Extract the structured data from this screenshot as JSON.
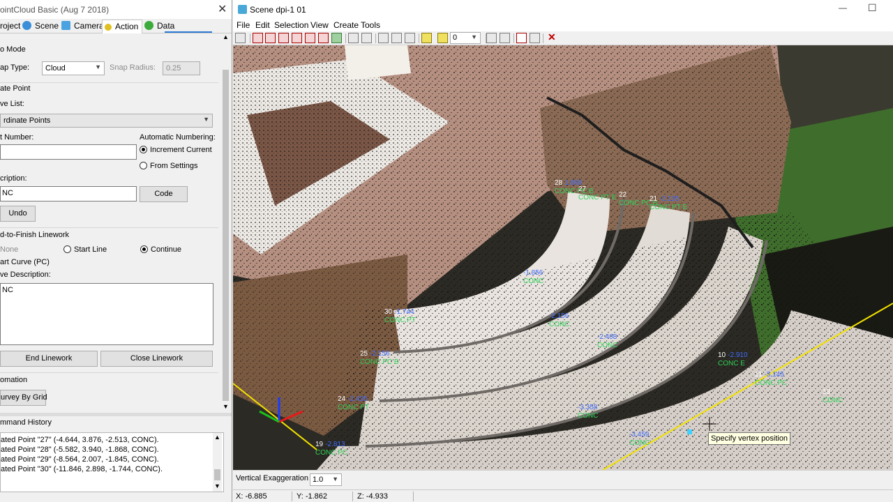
{
  "left_panel": {
    "title": "ointCloud Basic (Aug  7 2018)",
    "close_glyph": "✕",
    "tabs": [
      {
        "label": "roject",
        "icon": "project-icon"
      },
      {
        "label": "Scene",
        "icon": "scene-icon"
      },
      {
        "label": "Camera",
        "icon": "camera-icon"
      },
      {
        "label": "Action",
        "icon": "action-icon"
      },
      {
        "label": "Data",
        "icon": "data-icon"
      }
    ],
    "active_tab": "Action",
    "snap": {
      "group": "o Mode",
      "snap_type_label": "ap Type:",
      "snap_type_value": "Cloud",
      "snap_radius_label": "Snap Radius:",
      "snap_radius_value": "0.25"
    },
    "create_point": {
      "group": "ate Point",
      "save_list_label": "ve List:",
      "save_list_value": "rdinate Points",
      "point_number_label": "t Number:",
      "point_number_value": "",
      "auto_numbering_label": "Automatic Numbering:",
      "increment_current": "Increment Current",
      "from_settings": "From Settings",
      "description_label": "cription:",
      "description_value": "NC",
      "code_button": "Code",
      "undo_button": "Undo"
    },
    "linework": {
      "group": "d-to-Finish Linework",
      "none": "None",
      "start_line": "Start Line",
      "continue": "Continue",
      "start_curve": "art Curve (PC)",
      "curve_desc_label": "ve Description:",
      "curve_desc_value": "NC",
      "end_linework": "End Linework",
      "close_linework": "Close Linework"
    },
    "automation": {
      "group": "omation",
      "survey_by_grid": "urvey By Grid"
    },
    "command_history": {
      "label": "mmand History",
      "lines": [
        "ated Point \"27\" (-4.644, 3.876, -2.513, CONC).",
        "ated Point \"28\" (-5.582, 3.940, -1.868, CONC).",
        "ated Point \"29\" (-8.564, 2.007, -1.845, CONC).",
        "ated Point \"30\" (-11.846, 2.898, -1.744, CONC)."
      ]
    }
  },
  "scene_window": {
    "title": "Scene dpi-1 01",
    "minimize_glyph": "—",
    "maximize_glyph": "☐",
    "menu": [
      "File",
      "Edit",
      "Selection",
      "View",
      "Create",
      "Tools"
    ],
    "toolbar_combo_value": "0",
    "vertical_exaggeration_label": "Vertical Exaggeration",
    "vertical_exaggeration_value": "1.0",
    "status": {
      "x": "X: -6.885",
      "y": "Y: -1.862",
      "z": "Z: -4.933"
    },
    "tooltip": "Specify vertex position",
    "point_labels": [
      {
        "num": "28",
        "code": "CONC PC B",
        "val": "1.868"
      },
      {
        "num": "27",
        "code": "CONC PT E",
        "val": ""
      },
      {
        "num": "22",
        "code": "CONC PC B",
        "val": ""
      },
      {
        "num": "21",
        "code": "CONC PT E",
        "val": "-2.135"
      },
      {
        "num": "",
        "code": "CONC",
        "val": "-1.856"
      },
      {
        "num": "",
        "code": "CONC",
        "val": "-2.156"
      },
      {
        "num": "",
        "code": "CONC",
        "val": "-2.408"
      },
      {
        "num": "30",
        "code": "CONC PT",
        "val": "-1.744"
      },
      {
        "num": "25",
        "code": "CONC PC B",
        "val": "-2.156"
      },
      {
        "num": "10",
        "code": "CONC E",
        "val": "-2.910"
      },
      {
        "num": "24",
        "code": "CONC PT",
        "val": "-2.435"
      },
      {
        "num": "",
        "code": "CONC",
        "val": "-3.358"
      },
      {
        "num": "11",
        "code": "CONC PC",
        "val": "-3.145"
      },
      {
        "num": "13",
        "code": "CONC",
        "val": ""
      },
      {
        "num": "19",
        "code": "CONC PC",
        "val": "-2.813"
      },
      {
        "num": "",
        "code": "CONC",
        "val": "-3.459"
      }
    ]
  }
}
